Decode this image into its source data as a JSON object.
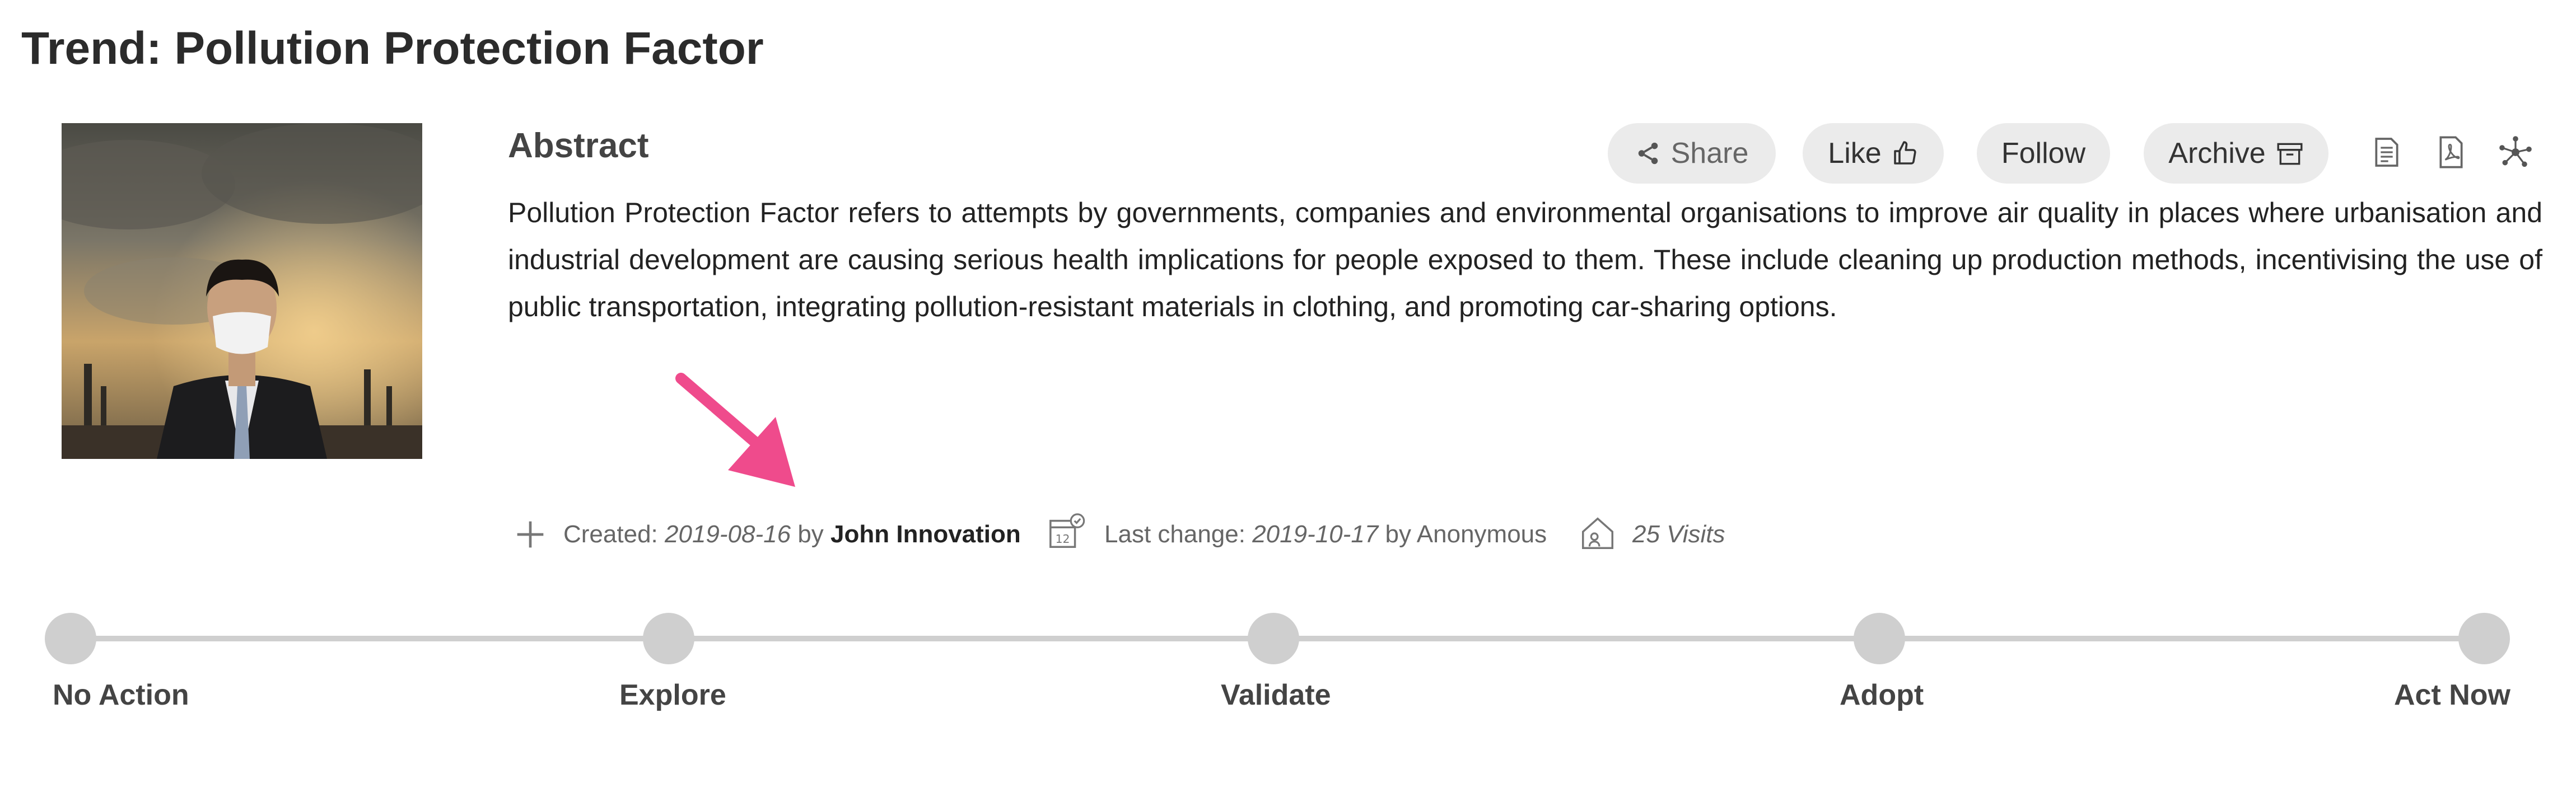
{
  "page": {
    "title": "Trend: Pollution Protection Factor"
  },
  "hero_image": {
    "description_icon": "masked-man-pollution-photo"
  },
  "abstract": {
    "heading": "Abstract",
    "text": "Pollution Protection Factor refers to attempts by governments, companies and environmental organisations to improve air quality in places where urbanisation and industrial development are causing serious health implications for people exposed to them. These include cleaning up production methods, incentivising the use of public transportation, integrating pollution-resistant materials in clothing, and promoting car-sharing options."
  },
  "toolbar": {
    "share_label": "Share",
    "like_label": "Like",
    "follow_label": "Follow",
    "archive_label": "Archive",
    "icons": [
      "share-icon",
      "thumbs-up-icon",
      "archive-box-icon",
      "document-icon",
      "pdf-icon",
      "network-icon"
    ]
  },
  "meta": {
    "created_label": "Created:",
    "created_date": "2019-08-16",
    "by_label": "by",
    "created_by": "John Innovation",
    "last_change_label": "Last change:",
    "last_change_date": "2019-10-17",
    "last_change_by": "by Anonymous",
    "visits": "25 Visits"
  },
  "stages": {
    "items": [
      "No Action",
      "Explore",
      "Validate",
      "Adopt",
      "Act Now"
    ]
  },
  "colors": {
    "accent_arrow": "#ef4b8c",
    "pill_bg": "#ebebeb",
    "track": "#cfcfcf"
  }
}
